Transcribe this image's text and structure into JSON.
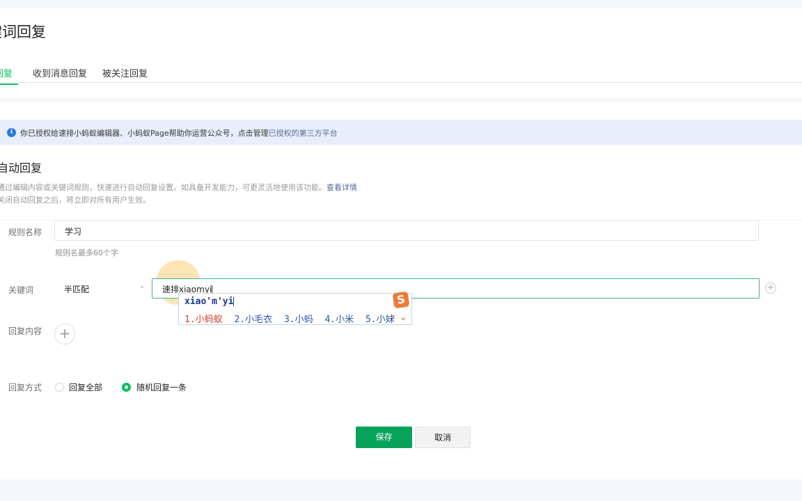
{
  "page": {
    "title": "键词回复"
  },
  "tabs": [
    {
      "label": "回复",
      "active": true
    },
    {
      "label": "收到消息回复",
      "active": false
    },
    {
      "label": "被关注回复",
      "active": false
    }
  ],
  "notice": {
    "icon": "info-icon",
    "text": "你已授权给速排小蚂蚁编辑器、小蚂蚁Page帮助你运营公众号，点击管理",
    "link": "已授权的第三方平台"
  },
  "section": {
    "title": "自动回复",
    "desc1": "通过编辑内容或关键词规则，快速进行自动回复设置。如具备开发能力，可更灵活地使用该功能。",
    "desc1_link": "查看详情",
    "desc2": "关闭自动回复之后，将立即对所有用户生效。"
  },
  "form": {
    "rule_name_label": "规则名称",
    "rule_name_value": "学习",
    "rule_name_hint": "规则名最多60个字",
    "keyword_label": "关键词",
    "match_mode": "半匹配",
    "keyword_value": "速排xiaomyi",
    "reply_content_label": "回复内容",
    "reply_mode_label": "回复方式",
    "reply_options": [
      {
        "label": "回复全部",
        "selected": false
      },
      {
        "label": "随机回复一条",
        "selected": true
      }
    ]
  },
  "ime": {
    "composition": "xiao'm'yi",
    "candidates": [
      "1.小蚂蚁",
      "2.小毛衣",
      "3.小蚂",
      "4.小米",
      "5.小妹"
    ],
    "logo": "S"
  },
  "actions": {
    "save": "保存",
    "cancel": "取消"
  },
  "colors": {
    "accent": "#07c160",
    "save_button": "#07a35b",
    "link": "#576b95",
    "notice_bg": "#e8eefb"
  }
}
